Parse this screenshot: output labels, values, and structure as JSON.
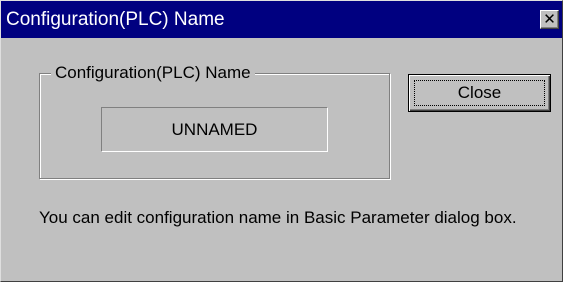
{
  "window": {
    "title": "Configuration(PLC) Name",
    "close_glyph": "✕"
  },
  "group": {
    "legend": "Configuration(PLC) Name",
    "value": "UNNAMED"
  },
  "buttons": {
    "close_label": "Close"
  },
  "message": "You can edit configuration name in Basic Parameter dialog box.",
  "colors": {
    "titlebar": "#000080",
    "face": "#c0c0c0",
    "title_text": "#ffffff"
  }
}
